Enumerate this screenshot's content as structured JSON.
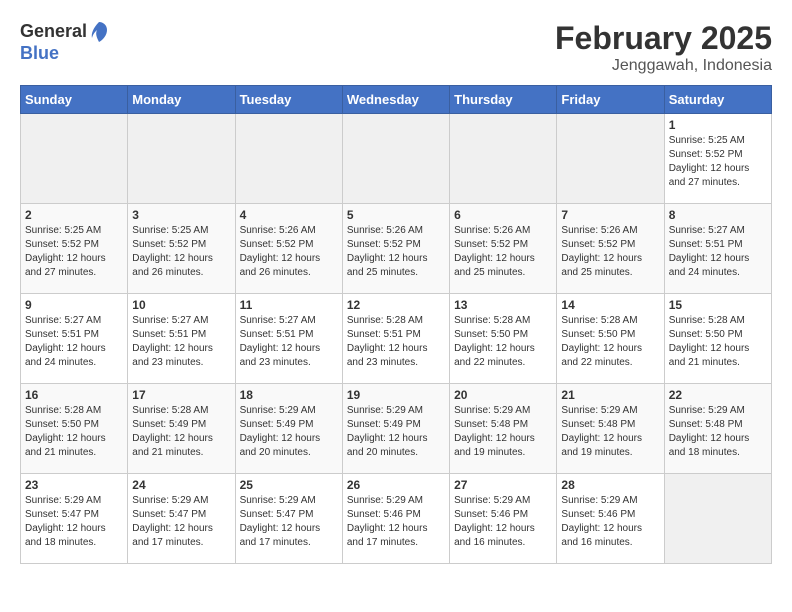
{
  "header": {
    "logo_general": "General",
    "logo_blue": "Blue",
    "month_year": "February 2025",
    "location": "Jenggawah, Indonesia"
  },
  "days_of_week": [
    "Sunday",
    "Monday",
    "Tuesday",
    "Wednesday",
    "Thursday",
    "Friday",
    "Saturday"
  ],
  "weeks": [
    [
      {
        "day": "",
        "info": ""
      },
      {
        "day": "",
        "info": ""
      },
      {
        "day": "",
        "info": ""
      },
      {
        "day": "",
        "info": ""
      },
      {
        "day": "",
        "info": ""
      },
      {
        "day": "",
        "info": ""
      },
      {
        "day": "1",
        "info": "Sunrise: 5:25 AM\nSunset: 5:52 PM\nDaylight: 12 hours\nand 27 minutes."
      }
    ],
    [
      {
        "day": "2",
        "info": "Sunrise: 5:25 AM\nSunset: 5:52 PM\nDaylight: 12 hours\nand 27 minutes."
      },
      {
        "day": "3",
        "info": "Sunrise: 5:25 AM\nSunset: 5:52 PM\nDaylight: 12 hours\nand 26 minutes."
      },
      {
        "day": "4",
        "info": "Sunrise: 5:26 AM\nSunset: 5:52 PM\nDaylight: 12 hours\nand 26 minutes."
      },
      {
        "day": "5",
        "info": "Sunrise: 5:26 AM\nSunset: 5:52 PM\nDaylight: 12 hours\nand 25 minutes."
      },
      {
        "day": "6",
        "info": "Sunrise: 5:26 AM\nSunset: 5:52 PM\nDaylight: 12 hours\nand 25 minutes."
      },
      {
        "day": "7",
        "info": "Sunrise: 5:26 AM\nSunset: 5:52 PM\nDaylight: 12 hours\nand 25 minutes."
      },
      {
        "day": "8",
        "info": "Sunrise: 5:27 AM\nSunset: 5:51 PM\nDaylight: 12 hours\nand 24 minutes."
      }
    ],
    [
      {
        "day": "9",
        "info": "Sunrise: 5:27 AM\nSunset: 5:51 PM\nDaylight: 12 hours\nand 24 minutes."
      },
      {
        "day": "10",
        "info": "Sunrise: 5:27 AM\nSunset: 5:51 PM\nDaylight: 12 hours\nand 23 minutes."
      },
      {
        "day": "11",
        "info": "Sunrise: 5:27 AM\nSunset: 5:51 PM\nDaylight: 12 hours\nand 23 minutes."
      },
      {
        "day": "12",
        "info": "Sunrise: 5:28 AM\nSunset: 5:51 PM\nDaylight: 12 hours\nand 23 minutes."
      },
      {
        "day": "13",
        "info": "Sunrise: 5:28 AM\nSunset: 5:50 PM\nDaylight: 12 hours\nand 22 minutes."
      },
      {
        "day": "14",
        "info": "Sunrise: 5:28 AM\nSunset: 5:50 PM\nDaylight: 12 hours\nand 22 minutes."
      },
      {
        "day": "15",
        "info": "Sunrise: 5:28 AM\nSunset: 5:50 PM\nDaylight: 12 hours\nand 21 minutes."
      }
    ],
    [
      {
        "day": "16",
        "info": "Sunrise: 5:28 AM\nSunset: 5:50 PM\nDaylight: 12 hours\nand 21 minutes."
      },
      {
        "day": "17",
        "info": "Sunrise: 5:28 AM\nSunset: 5:49 PM\nDaylight: 12 hours\nand 21 minutes."
      },
      {
        "day": "18",
        "info": "Sunrise: 5:29 AM\nSunset: 5:49 PM\nDaylight: 12 hours\nand 20 minutes."
      },
      {
        "day": "19",
        "info": "Sunrise: 5:29 AM\nSunset: 5:49 PM\nDaylight: 12 hours\nand 20 minutes."
      },
      {
        "day": "20",
        "info": "Sunrise: 5:29 AM\nSunset: 5:48 PM\nDaylight: 12 hours\nand 19 minutes."
      },
      {
        "day": "21",
        "info": "Sunrise: 5:29 AM\nSunset: 5:48 PM\nDaylight: 12 hours\nand 19 minutes."
      },
      {
        "day": "22",
        "info": "Sunrise: 5:29 AM\nSunset: 5:48 PM\nDaylight: 12 hours\nand 18 minutes."
      }
    ],
    [
      {
        "day": "23",
        "info": "Sunrise: 5:29 AM\nSunset: 5:47 PM\nDaylight: 12 hours\nand 18 minutes."
      },
      {
        "day": "24",
        "info": "Sunrise: 5:29 AM\nSunset: 5:47 PM\nDaylight: 12 hours\nand 17 minutes."
      },
      {
        "day": "25",
        "info": "Sunrise: 5:29 AM\nSunset: 5:47 PM\nDaylight: 12 hours\nand 17 minutes."
      },
      {
        "day": "26",
        "info": "Sunrise: 5:29 AM\nSunset: 5:46 PM\nDaylight: 12 hours\nand 17 minutes."
      },
      {
        "day": "27",
        "info": "Sunrise: 5:29 AM\nSunset: 5:46 PM\nDaylight: 12 hours\nand 16 minutes."
      },
      {
        "day": "28",
        "info": "Sunrise: 5:29 AM\nSunset: 5:46 PM\nDaylight: 12 hours\nand 16 minutes."
      },
      {
        "day": "",
        "info": ""
      }
    ]
  ]
}
